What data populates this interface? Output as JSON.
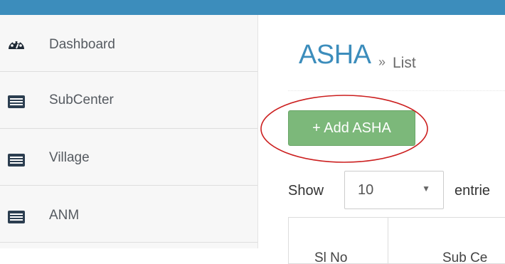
{
  "sidebar": {
    "items": [
      {
        "label": "Dashboard",
        "icon": "dashboard-icon"
      },
      {
        "label": "SubCenter",
        "icon": "list-icon"
      },
      {
        "label": "Village",
        "icon": "list-icon"
      },
      {
        "label": "ANM",
        "icon": "list-icon"
      }
    ]
  },
  "page": {
    "title": "ASHA",
    "breadcrumb_separator": "»",
    "breadcrumb": "List"
  },
  "actions": {
    "add_label": "+ Add ASHA"
  },
  "table_controls": {
    "show_label": "Show",
    "length_value": "10",
    "entries_label": "entrie"
  },
  "table": {
    "headers": [
      "Sl No",
      "Sub Ce"
    ]
  },
  "colors": {
    "topbar": "#3c8dbc",
    "title": "#3c8dbc",
    "add_button": "#7cb87a",
    "highlight_ring": "#cc1f1f"
  }
}
